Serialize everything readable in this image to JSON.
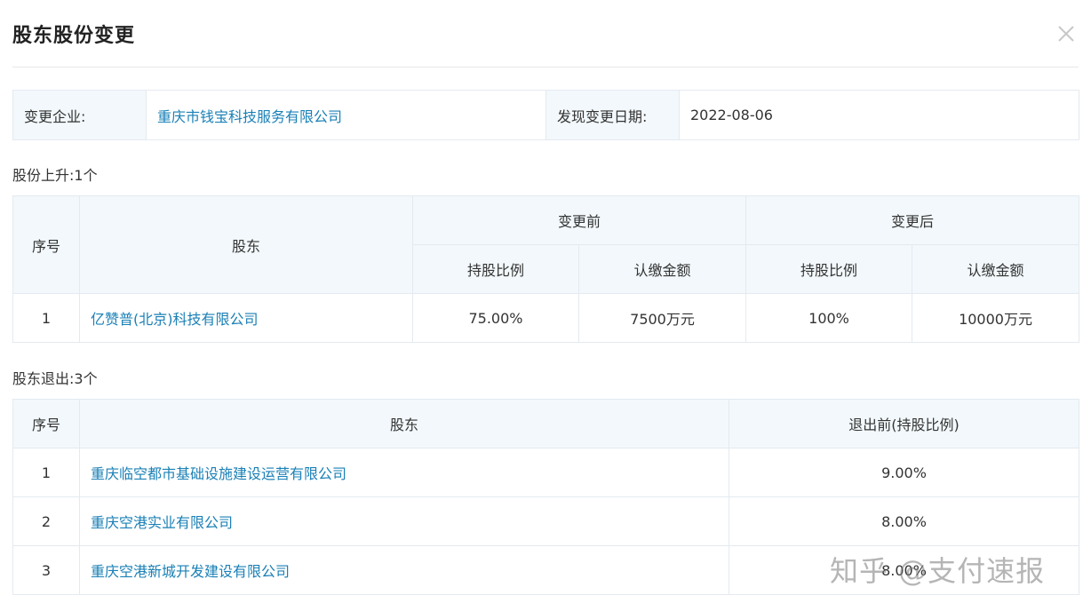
{
  "dialog": {
    "title": "股东股份变更",
    "close_icon": "close-icon"
  },
  "info": {
    "company_label": "变更企业:",
    "company_name": "重庆市钱宝科技服务有限公司",
    "date_label": "发现变更日期:",
    "date_value": "2022-08-06"
  },
  "rise": {
    "section_label": "股份上升:1个",
    "headers": {
      "index": "序号",
      "shareholder": "股东",
      "before": "变更前",
      "after": "变更后",
      "ratio": "持股比例",
      "amount": "认缴金额"
    },
    "rows": [
      {
        "index": "1",
        "shareholder": "亿赞普(北京)科技有限公司",
        "before_ratio": "75.00%",
        "before_amount": "7500万元",
        "after_ratio": "100%",
        "after_amount": "10000万元"
      }
    ]
  },
  "exit": {
    "section_label": "股东退出:3个",
    "headers": {
      "index": "序号",
      "shareholder": "股东",
      "ratio_before": "退出前(持股比例)"
    },
    "rows": [
      {
        "index": "1",
        "shareholder": "重庆临空都市基础设施建设运营有限公司",
        "ratio": "9.00%"
      },
      {
        "index": "2",
        "shareholder": "重庆空港实业有限公司",
        "ratio": "8.00%"
      },
      {
        "index": "3",
        "shareholder": "重庆空港新城开发建设有限公司",
        "ratio": "8.00%"
      }
    ]
  },
  "watermark": "知乎 @支付速报",
  "colors": {
    "link": "#1a80b6",
    "header_bg": "#f2f8fb",
    "border": "#e4eaf0"
  }
}
